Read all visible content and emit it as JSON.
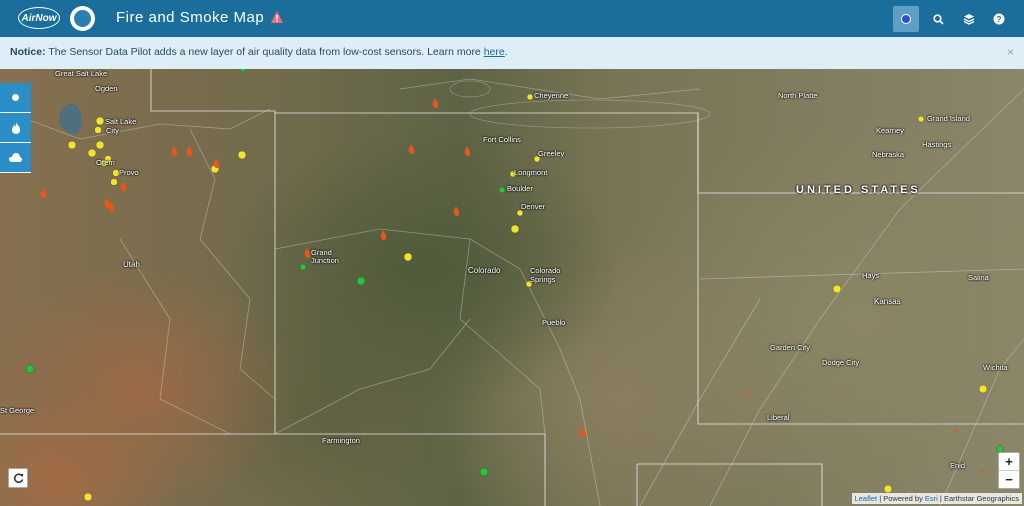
{
  "header": {
    "logo_text": "AirNow",
    "title": "Fire and Smoke Map"
  },
  "notice": {
    "label": "Notice:",
    "text": " The Sensor Data Pilot adds a new layer of air quality data from low-cost sensors. Learn more ",
    "link": "here",
    "end": ".",
    "close": "×"
  },
  "map": {
    "country": "UNITED STATES",
    "states": [
      "Utah",
      "Colorado",
      "Kansas"
    ],
    "cities": [
      {
        "name": "Ogden"
      },
      {
        "name": "Salt Lake"
      },
      {
        "name": "City"
      },
      {
        "name": "Great Salt Lake"
      },
      {
        "name": "Orem"
      },
      {
        "name": "Provo"
      },
      {
        "name": "Cheyenne"
      },
      {
        "name": "Fort Collins"
      },
      {
        "name": "Greeley"
      },
      {
        "name": "Longmont"
      },
      {
        "name": "Boulder"
      },
      {
        "name": "Denver"
      },
      {
        "name": "Grand"
      },
      {
        "name": "Junction"
      },
      {
        "name": "Colorado"
      },
      {
        "name": "Springs"
      },
      {
        "name": "Pueblo"
      },
      {
        "name": "North Platte"
      },
      {
        "name": "Kearney"
      },
      {
        "name": "Grand Island"
      },
      {
        "name": "Nebraska"
      },
      {
        "name": "Hastings"
      },
      {
        "name": "Hays"
      },
      {
        "name": "Salina"
      },
      {
        "name": "Garden City"
      },
      {
        "name": "Dodge City"
      },
      {
        "name": "Wichita"
      },
      {
        "name": "Liberal"
      },
      {
        "name": "Farmington"
      },
      {
        "name": "Enid"
      },
      {
        "name": "St George"
      }
    ]
  },
  "attribution": {
    "leaflet": "Leaflet",
    "sep1": " | Powered by ",
    "esri": "Esri",
    "rest": " | Earthstar Geographics"
  },
  "colors": {
    "header": "#1b6e9c",
    "notice": "#ddeef6",
    "sensor_yellow": "#f2e426",
    "sensor_green": "#2fbf3c",
    "fire": "#e8561b"
  },
  "icons": {
    "search": "search-icon",
    "layers": "layers-icon",
    "help": "help-icon",
    "warning": "warning-icon",
    "fire": "fire-icon",
    "smoke": "cloud-icon",
    "refresh": "refresh-icon"
  },
  "zoom": {
    "in": "+",
    "out": "−"
  }
}
